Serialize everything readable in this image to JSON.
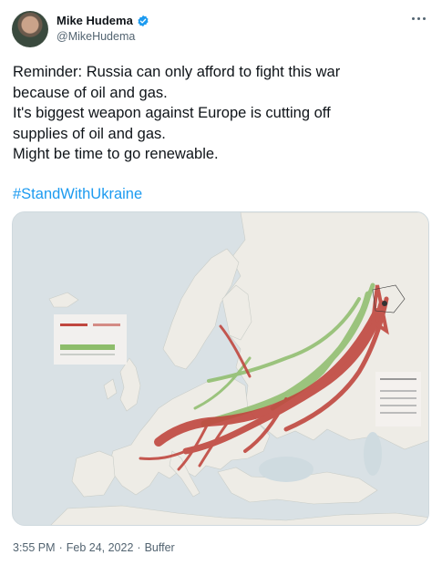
{
  "author": {
    "name": "Mike Hudema",
    "handle": "@MikeHudema",
    "verified": true,
    "avatar_icon": "avatar-photo",
    "verified_icon": "verified-badge-icon",
    "verified_color": "#1d9bf0"
  },
  "menu_icon": "more-options-icon",
  "tweet": {
    "lines": [
      "Reminder: Russia can only afford to fight this war",
      "because of oil and gas.",
      "It's biggest weapon against Europe is cutting off",
      "supplies of oil and gas.",
      "Might be time to go renewable."
    ],
    "hashtag": "#StandWithUkraine",
    "hashtag_color": "#1d9bf0"
  },
  "media": {
    "type": "map-image",
    "pipeline_colors": {
      "oil": "#c0473f",
      "gas": "#8dbd6b"
    }
  },
  "footer": {
    "time": "3:55 PM",
    "separator": "·",
    "date": "Feb 24, 2022",
    "source": "Buffer"
  }
}
